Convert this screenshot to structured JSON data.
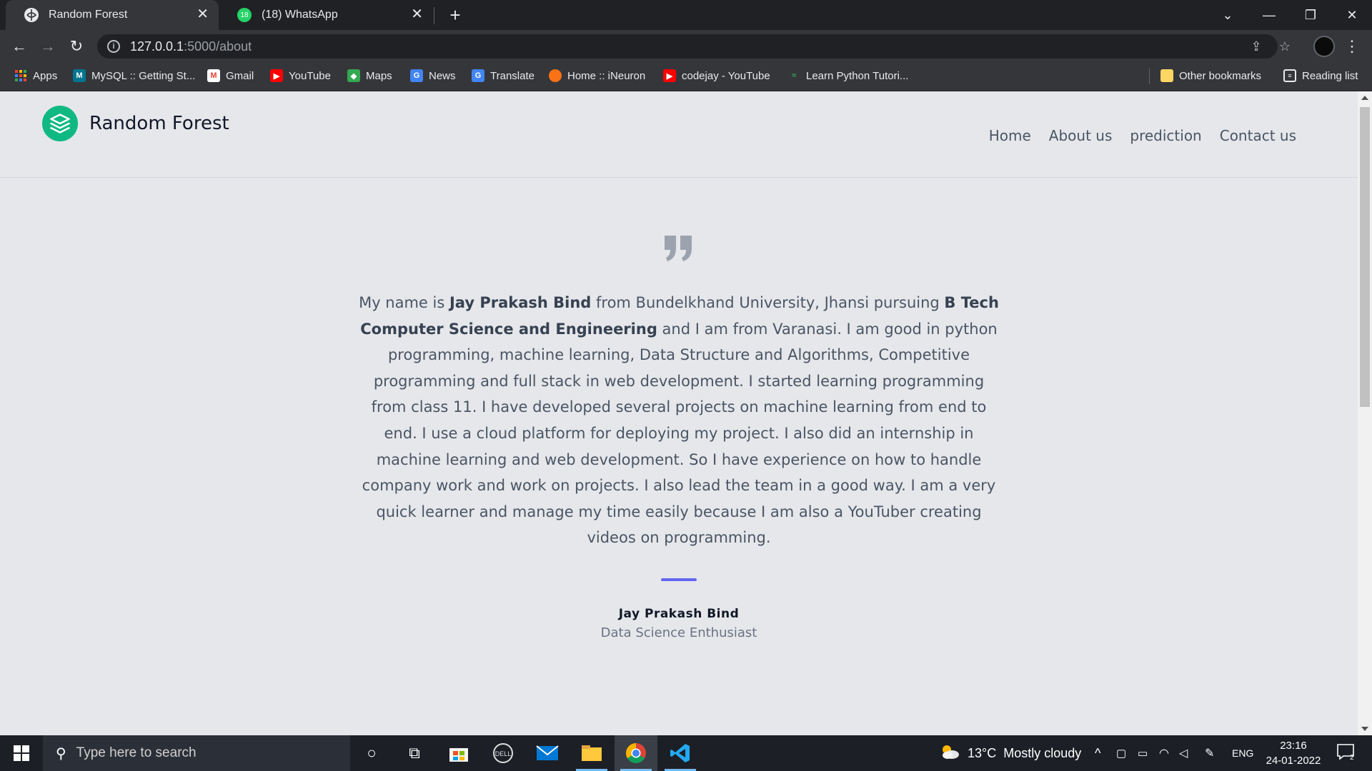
{
  "browser": {
    "tabs": [
      {
        "title": "Random Forest",
        "active": true
      },
      {
        "title": "(18) WhatsApp",
        "active": false,
        "badge": "18"
      }
    ],
    "new_tab": "+",
    "url_host": "127.0.0.1",
    "url_path": ":5000/about",
    "bookmarks": [
      {
        "label": "Apps",
        "icon": "apps-grid-icon",
        "color": "#ea4335"
      },
      {
        "label": "MySQL :: Getting St...",
        "icon": "mysql-icon",
        "color": "#00758f"
      },
      {
        "label": "Gmail",
        "icon": "gmail-icon",
        "color": "#ea4335"
      },
      {
        "label": "YouTube",
        "icon": "youtube-icon",
        "color": "#ff0000"
      },
      {
        "label": "Maps",
        "icon": "maps-icon",
        "color": "#34a853"
      },
      {
        "label": "News",
        "icon": "news-icon",
        "color": "#4285f4"
      },
      {
        "label": "Translate",
        "icon": "translate-icon",
        "color": "#4285f4"
      },
      {
        "label": "Home :: iNeuron",
        "icon": "ineuron-icon",
        "color": "#f97316"
      },
      {
        "label": "codejay - YouTube",
        "icon": "youtube-icon",
        "color": "#ff0000"
      },
      {
        "label": "Learn Python Tutori...",
        "icon": "python-icon",
        "color": "#34a853"
      }
    ],
    "other_bookmarks": "Other bookmarks",
    "reading_list": "Reading list"
  },
  "site": {
    "brand": "Random Forest",
    "brand_color": "#10b981",
    "nav": [
      "Home",
      "About us",
      "prediction",
      "Contact us"
    ]
  },
  "testimonial": {
    "segments": [
      {
        "text": "My name is ",
        "bold": false
      },
      {
        "text": "Jay Prakash Bind",
        "bold": true
      },
      {
        "text": " from Bundelkhand University, Jhansi pursuing ",
        "bold": false
      },
      {
        "text": "B Tech Computer Science and Engineering",
        "bold": true
      },
      {
        "text": " and I am from Varanasi. I am good in python programming, machine learning, Data Structure and Algorithms, Competitive programming and full stack in web development. I started learning programming from class 11. I have developed several projects on machine learning from end to end. I use a cloud platform for deploying my project. I also did an internship in machine learning and web development. So I have experience on how to handle company work and work on projects. I also lead the team in a good way. I am a very quick learner and manage my time easily because I am also a YouTuber creating videos on programming.",
        "bold": false
      }
    ],
    "accent_color": "#6366f1",
    "author_name": "Jay Prakash Bind",
    "author_title": "Data Science Enthusiast"
  },
  "taskbar": {
    "search_placeholder": "Type here to search",
    "weather": "13°C  Mostly cloudy",
    "language": "ENG",
    "time": "23:16",
    "date": "24-01-2022",
    "notification_count": "2"
  }
}
